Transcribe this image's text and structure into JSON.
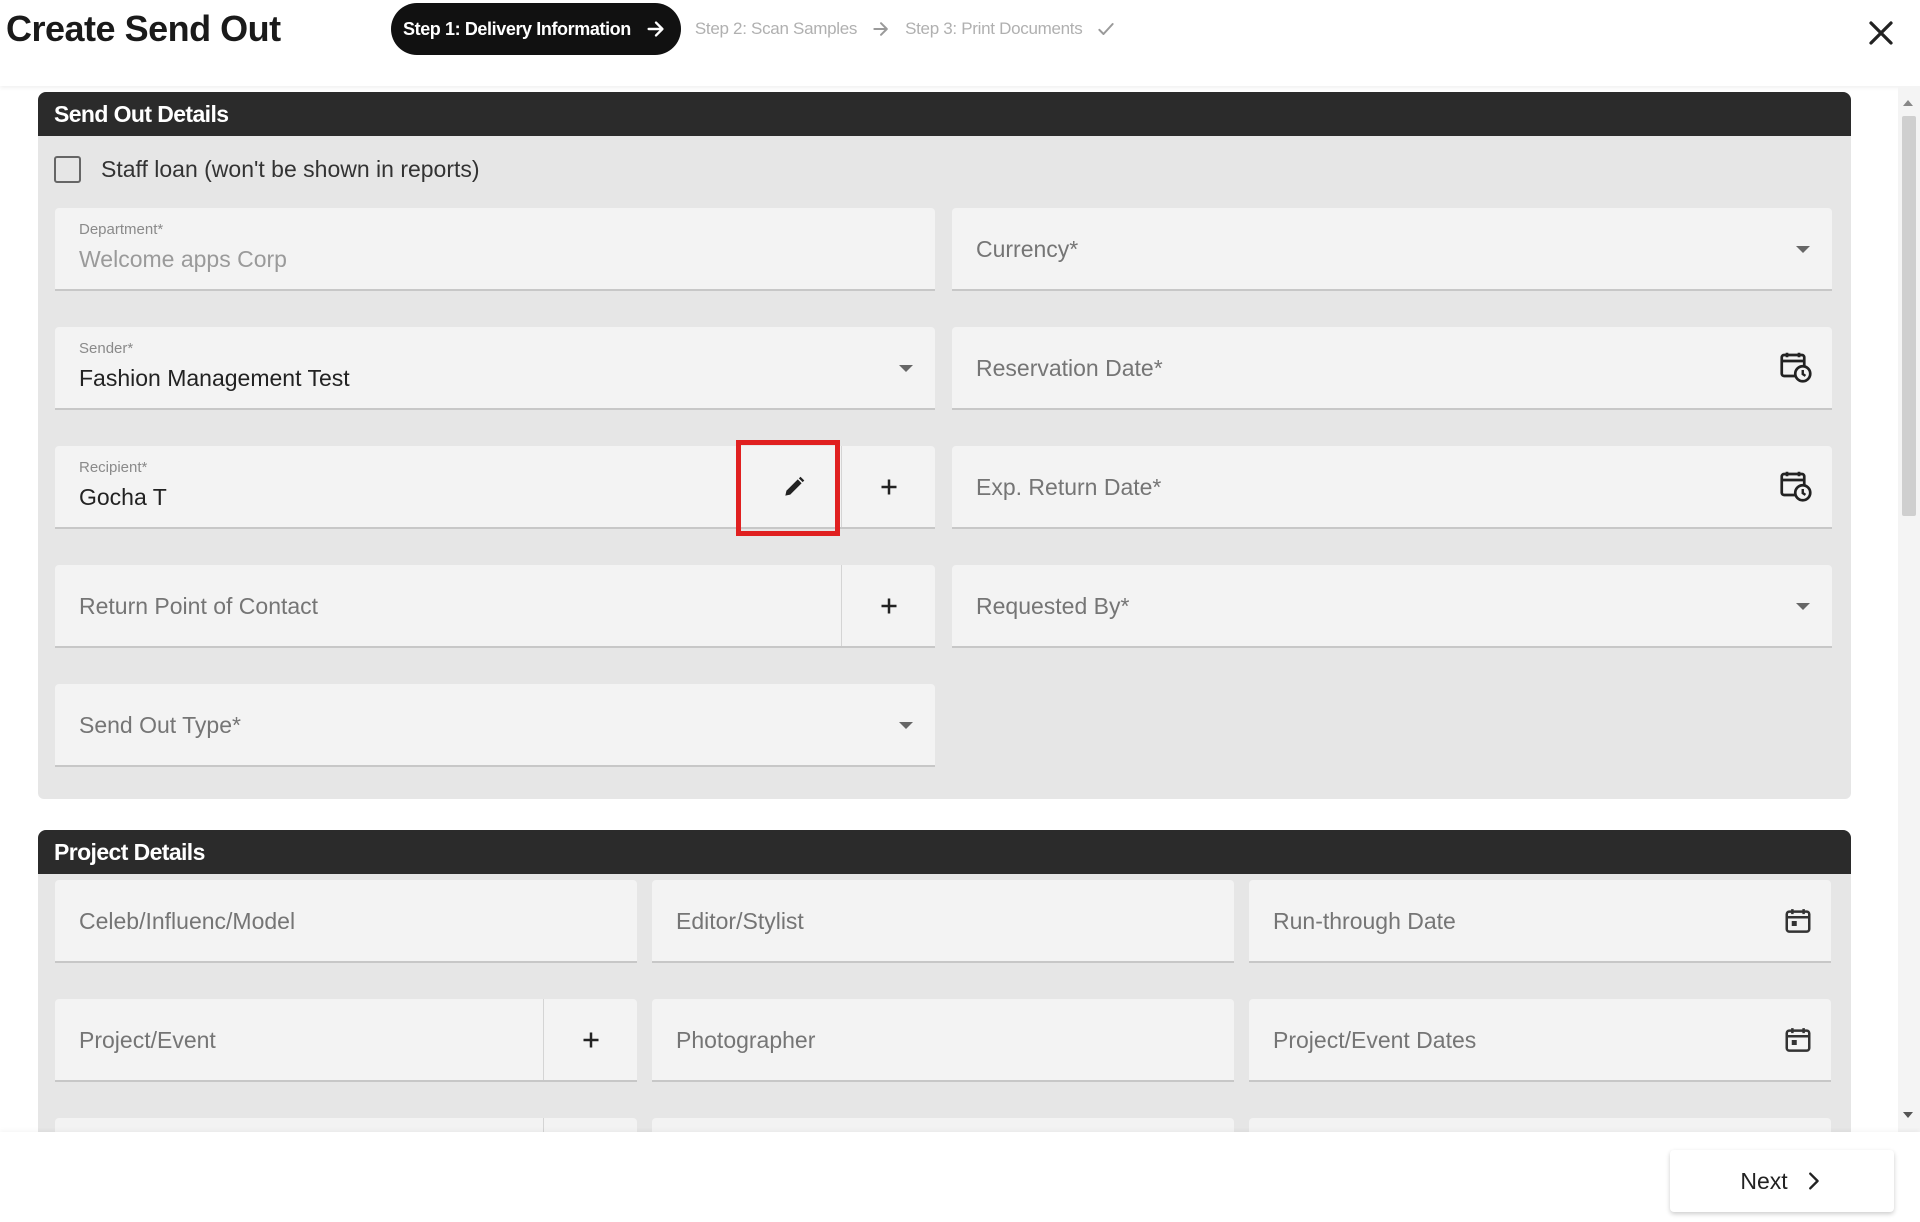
{
  "header": {
    "title": "Create Send Out",
    "steps": [
      {
        "label": "Step 1: Delivery Information",
        "active": true
      },
      {
        "label": "Step 2: Scan Samples",
        "active": false
      },
      {
        "label": "Step 3: Print Documents",
        "active": false
      }
    ]
  },
  "send_out_details": {
    "title": "Send Out Details",
    "staff_loan_label": "Staff loan (won't be shown in reports)",
    "staff_loan_checked": false,
    "department": {
      "label": "Department*",
      "value": "Welcome apps Corp"
    },
    "currency": {
      "placeholder": "Currency*"
    },
    "sender": {
      "label": "Sender*",
      "value": "Fashion Management Test"
    },
    "reservation_date": {
      "placeholder": "Reservation Date*"
    },
    "recipient": {
      "label": "Recipient*",
      "value": "Gocha T"
    },
    "exp_return_date": {
      "placeholder": "Exp. Return Date*"
    },
    "return_point_of_contact": {
      "placeholder": "Return Point of Contact"
    },
    "requested_by": {
      "placeholder": "Requested By*"
    },
    "send_out_type": {
      "placeholder": "Send Out Type*"
    }
  },
  "project_details": {
    "title": "Project Details",
    "celeb": {
      "placeholder": "Celeb/Influenc/Model"
    },
    "editor_stylist": {
      "placeholder": "Editor/Stylist"
    },
    "run_through_date": {
      "placeholder": "Run-through Date"
    },
    "project_event": {
      "placeholder": "Project/Event"
    },
    "photographer": {
      "placeholder": "Photographer"
    },
    "project_event_dates": {
      "placeholder": "Project/Event Dates"
    }
  },
  "footer": {
    "next_label": "Next"
  },
  "icons": {
    "step_arrow": "arrow-right-icon",
    "step_done": "check-icon",
    "close": "close-icon",
    "dropdown": "chevron-down-icon",
    "calendar_clock": "calendar-clock-icon",
    "calendar": "calendar-icon",
    "edit": "pencil-icon",
    "add": "plus-icon",
    "next": "chevron-right-icon"
  },
  "colors": {
    "section_header": "#2b2b2b",
    "section_bg": "#e6e6e6",
    "field_bg": "#f3f3f3",
    "highlight": "#e02020",
    "active_step": "#111111"
  }
}
